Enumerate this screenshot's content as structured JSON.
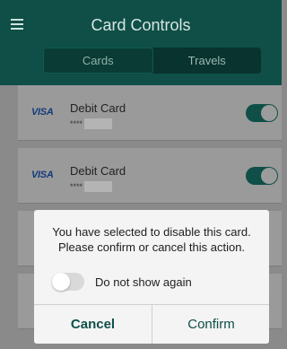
{
  "header": {
    "title": "Card Controls",
    "tabs": [
      {
        "label": "Cards"
      },
      {
        "label": "Travels"
      }
    ]
  },
  "cards": [
    {
      "brand": "VISA",
      "name": "Debit Card",
      "masked": "****",
      "enabled": true
    },
    {
      "brand": "VISA",
      "name": "Debit Card",
      "masked": "****",
      "enabled": true
    }
  ],
  "dialog": {
    "message_line1": "You have selected to disable this card.",
    "message_line2": "Please confirm or cancel this action.",
    "do_not_show_label": "Do not show again",
    "cancel_label": "Cancel",
    "confirm_label": "Confirm"
  },
  "colors": {
    "header": "#0f4f47",
    "accent": "#0f4f47"
  }
}
